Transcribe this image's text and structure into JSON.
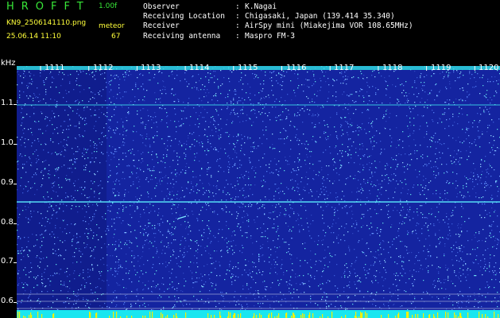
{
  "header": {
    "app_title": "HROFFT",
    "version": "1.00f",
    "filename": "KN9_2506141110.png",
    "meteor_label": "meteor",
    "datetime": "25.06.14 11:10",
    "meteor_count": "67"
  },
  "info": [
    {
      "key": "Observer",
      "value": "K.Nagai"
    },
    {
      "key": "Receiving Location",
      "value": "Chigasaki, Japan (139.414 35.340)"
    },
    {
      "key": "Receiver",
      "value": "AirSpy mini (Miakejima VOR 108.65MHz)"
    },
    {
      "key": "Receiving antenna",
      "value": "Maspro FM-3"
    }
  ],
  "info_separator": ":",
  "axis": {
    "unit": "kHz",
    "y_ticks": [
      "1.1",
      "1.0",
      "0.9",
      "0.8",
      "0.7",
      "0.6"
    ],
    "minutes": [
      "1111",
      "1112",
      "1113",
      "1114",
      "1115",
      "1116",
      "1117",
      "1118",
      "1119",
      "1120"
    ]
  },
  "colors": {
    "background": "#000000",
    "plot_bg": "#1424a0",
    "title_green": "#38e838",
    "label_yellow": "#ffff3a",
    "signal_cyan": "#38e6e6"
  }
}
